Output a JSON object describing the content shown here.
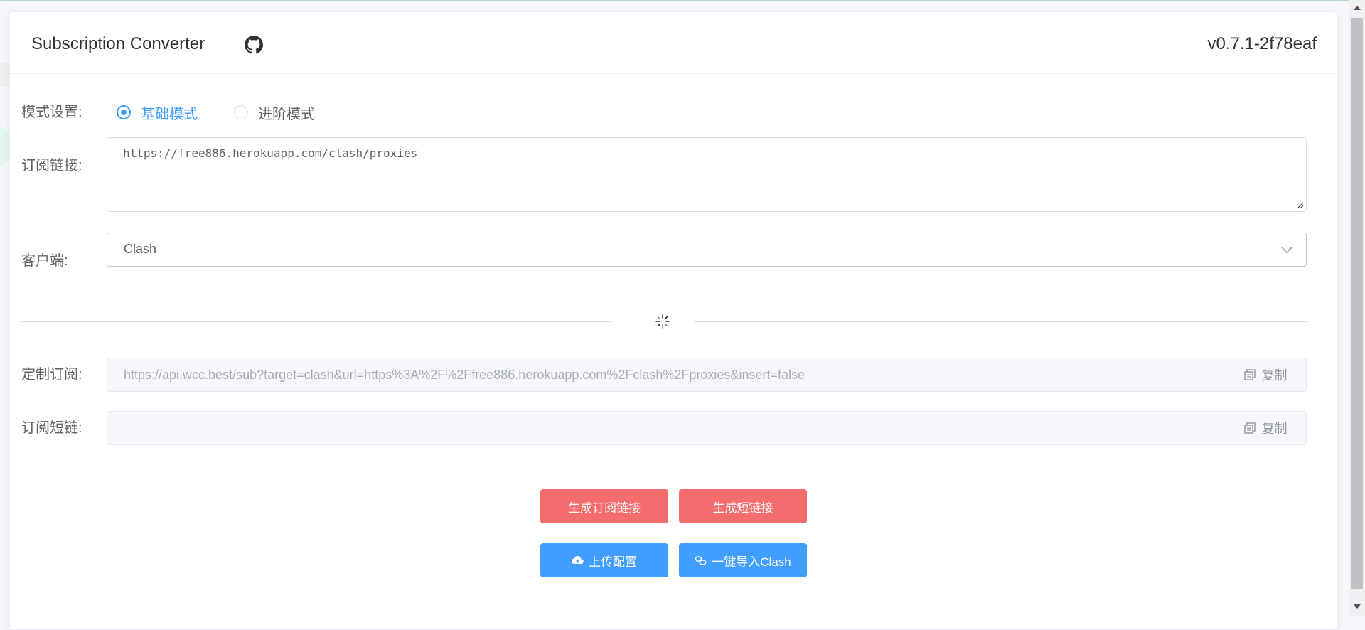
{
  "header": {
    "title": "Subscription Converter",
    "version": "v0.7.1-2f78eaf"
  },
  "form": {
    "mode_label": "模式设置:",
    "mode_options": [
      {
        "label": "基础模式",
        "checked": true
      },
      {
        "label": "进阶模式",
        "checked": false
      }
    ],
    "subscription_label": "订阅链接:",
    "subscription_value": "https://free886.herokuapp.com/clash/proxies",
    "client_label": "客户端:",
    "client_value": "Clash",
    "custom_sub_label": "定制订阅:",
    "custom_sub_value": "https://api.wcc.best/sub?target=clash&url=https%3A%2F%2Ffree886.herokuapp.com%2Fclash%2Fproxies&insert=false",
    "short_link_label": "订阅短链:",
    "short_link_value": "",
    "copy_label": "复制"
  },
  "buttons": {
    "generate_sub": "生成订阅链接",
    "generate_short": "生成短链接",
    "upload_config": "上传配置",
    "import_clash": "一键导入Clash"
  },
  "colors": {
    "primary": "#409eff",
    "danger": "#f56c6c",
    "border": "#dcdfe6",
    "text": "#606266"
  },
  "icons": {
    "github": "github-icon",
    "loading": "loading-spinner-icon",
    "copy": "copy-icon",
    "upload": "cloud-upload-icon",
    "link": "link-icon",
    "chevron": "chevron-down-icon"
  }
}
